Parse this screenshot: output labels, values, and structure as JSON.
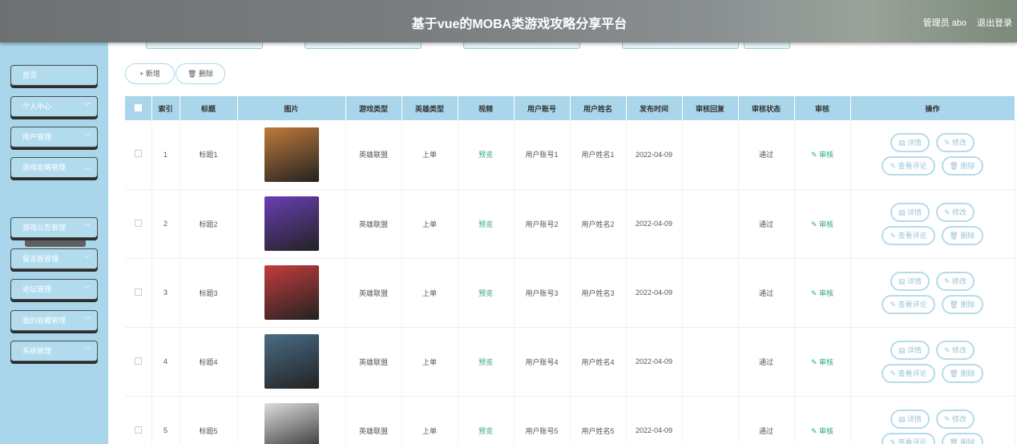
{
  "header": {
    "title": "基于vue的MOBA类游戏攻略分享平台",
    "user": "管理员 abo",
    "logout": "退出登录"
  },
  "sidebar": {
    "items": [
      {
        "label": "首页",
        "has_chevron": false
      },
      {
        "label": "个人中心",
        "has_chevron": true
      },
      {
        "label": "用户管理",
        "has_chevron": true
      },
      {
        "label": "游戏攻略管理",
        "has_chevron": true
      },
      {
        "label": "游戏公告管理",
        "has_chevron": true
      },
      {
        "label": "留言板管理",
        "has_chevron": true
      },
      {
        "label": "论坛管理",
        "has_chevron": true
      },
      {
        "label": "我的收藏管理",
        "has_chevron": true
      },
      {
        "label": "系统管理",
        "has_chevron": true
      }
    ],
    "submenu_active": "游戏攻略"
  },
  "toolbar": {
    "add_label": "+ 新增",
    "delete_label": "🗑 删除"
  },
  "table": {
    "headers": [
      "索引",
      "标题",
      "图片",
      "游戏类型",
      "英雄类型",
      "视频",
      "用户账号",
      "用户姓名",
      "发布时间",
      "审核回复",
      "审核状态",
      "审核",
      "操作"
    ],
    "rows": [
      {
        "index": "1",
        "title": "标题1",
        "game_type": "英雄联盟",
        "hero_type": "上单",
        "video": "预览",
        "account": "用户账号1",
        "name": "用户姓名1",
        "date": "2022-04-09",
        "reply": "",
        "status": "通过",
        "audit": "审核",
        "image_color": "#c07a3a"
      },
      {
        "index": "2",
        "title": "标题2",
        "game_type": "英雄联盟",
        "hero_type": "上单",
        "video": "预览",
        "account": "用户账号2",
        "name": "用户姓名2",
        "date": "2022-04-09",
        "reply": "",
        "status": "通过",
        "audit": "审核",
        "image_color": "#6a3fb5"
      },
      {
        "index": "3",
        "title": "标题3",
        "game_type": "英雄联盟",
        "hero_type": "上单",
        "video": "预览",
        "account": "用户账号3",
        "name": "用户姓名3",
        "date": "2022-04-09",
        "reply": "",
        "status": "通过",
        "audit": "审核",
        "image_color": "#c43c3c"
      },
      {
        "index": "4",
        "title": "标题4",
        "game_type": "英雄联盟",
        "hero_type": "上单",
        "video": "预览",
        "account": "用户账号4",
        "name": "用户姓名4",
        "date": "2022-04-09",
        "reply": "",
        "status": "通过",
        "audit": "审核",
        "image_color": "#4a6c86"
      },
      {
        "index": "5",
        "title": "标题5",
        "game_type": "英雄联盟",
        "hero_type": "上单",
        "video": "预览",
        "account": "用户账号5",
        "name": "用户姓名5",
        "date": "2022-04-09",
        "reply": "",
        "status": "通过",
        "audit": "审核",
        "image_color": "#dddddd"
      }
    ],
    "op_labels": {
      "detail": "详情",
      "edit": "修改",
      "comments": "查看评论",
      "delete": "删除"
    },
    "preview_icon": "✎"
  }
}
